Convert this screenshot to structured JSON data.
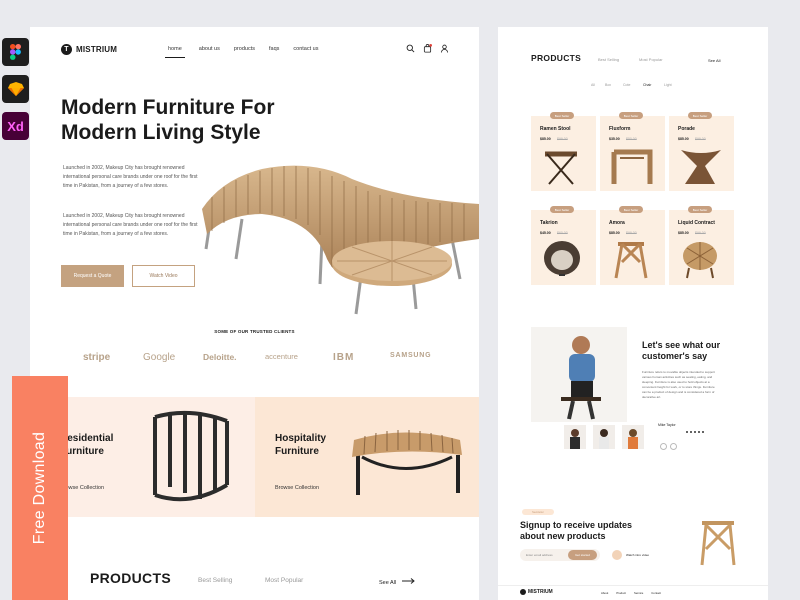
{
  "tools": [
    "figma-icon",
    "sketch-icon",
    "Xd"
  ],
  "brand": {
    "name": "MISTRIUM",
    "accent": "#c4a280",
    "coral": "#f98162"
  },
  "nav": {
    "links": [
      "home",
      "about us",
      "products",
      "faqs",
      "contact us"
    ],
    "active": "home",
    "icons": [
      "search-icon",
      "cart-icon",
      "user-icon"
    ]
  },
  "hero": {
    "title_line1": "Modern Furniture For",
    "title_line2": "Modern Living Style",
    "para1": "Launched in 2002, Makeup City has brought renowned international personal care brands under one roof for the first time in Pakistan, from a journey of a few stores.",
    "para2": "Launched in 2002, Makeup City has brought renowned international personal care brands under one roof for the first time in Pakistan, from a journey of a few stores.",
    "btn_quote": "Request a Quote",
    "btn_video": "Watch Video"
  },
  "clients": {
    "title": "SOME OF OUR TRUSTED CLIENTS",
    "logos": [
      "stripe",
      "Google",
      "Deloitte.",
      "accenture",
      "IBM",
      "SAMSUNG"
    ]
  },
  "categories": [
    {
      "title_line1": "Residential",
      "title_line2": "Furniture",
      "link": "Browse Collection"
    },
    {
      "title_line1": "Hospitality",
      "title_line2": "Furniture",
      "link": "Browse Collection"
    }
  ],
  "products_section": {
    "title": "PRODUCTS",
    "tabs": [
      "Best Selling",
      "Most Popular"
    ],
    "see_all": "See All"
  },
  "ribbon": "Free Download",
  "right": {
    "products_title": "PRODUCTS",
    "tabs": [
      "Best Selling",
      "Most Popular"
    ],
    "see_all": "See All",
    "filters": [
      "All",
      "Box",
      "Cote",
      "Chair",
      "Light"
    ],
    "active_filter": "Chair",
    "cards": [
      {
        "tag": "Best Seller",
        "name": "Ramen Stool",
        "price": "$85.00",
        "old": "$99.00"
      },
      {
        "tag": "Best Seller",
        "name": "Fluxform",
        "price": "$35.00",
        "old": "$50.00"
      },
      {
        "tag": "Best Seller",
        "name": "Porade",
        "price": "$85.00",
        "old": "$99.00"
      },
      {
        "tag": "Best Seller",
        "name": "Takrion",
        "price": "$45.00",
        "old": "$60.00"
      },
      {
        "tag": "Best Seller",
        "name": "Amora",
        "price": "$85.00",
        "old": "$99.00"
      },
      {
        "tag": "Best Seller",
        "name": "Liquid Contract",
        "price": "$85.00",
        "old": "$99.00"
      }
    ],
    "testimonial": {
      "title_line1": "Let's see what our",
      "title_line2": "customer's say",
      "text": "Furniture refers to movable objects intended to support various human activities such as seating, eating, and sleeping. Furniture is also used to hold objects at a convenient height for work, or to store things. Furniture can be a product of design and is considered a form of decorative art.",
      "name": "Mike Taylor"
    },
    "signup": {
      "tag": "Newsletter",
      "title_line1": "Signup to receive updates",
      "title_line2": "about new products",
      "placeholder": "Enter email address",
      "button": "Get started",
      "video": "Watch intro video"
    },
    "footer": {
      "brand": "MISTRIUM",
      "links": [
        "About",
        "Product",
        "Service",
        "Contact"
      ]
    }
  }
}
